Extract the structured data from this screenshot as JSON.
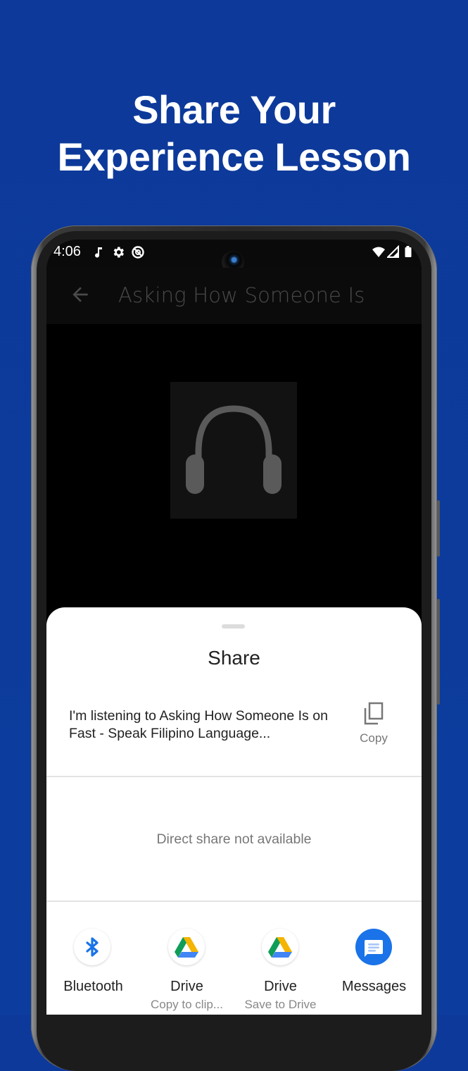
{
  "headline": {
    "line1": "Share Your",
    "line2": "Experience Lesson"
  },
  "status_bar": {
    "time": "4:06",
    "left_icons": [
      "music-note-icon",
      "settings-gear-icon",
      "no-data-icon"
    ],
    "right_icons": [
      "wifi-icon",
      "cell-signal-icon",
      "battery-icon"
    ]
  },
  "app_bar": {
    "back_icon": "arrow-back-icon",
    "title": "Asking How Someone Is"
  },
  "lesson_art": {
    "icon": "headphones-icon"
  },
  "share_sheet": {
    "title": "Share",
    "preview_text": "I'm listening to Asking How Someone Is on Fast - Speak Filipino Language...",
    "copy_label": "Copy",
    "direct_share_message": "Direct share not available",
    "targets": [
      {
        "name": "Bluetooth",
        "subtitle": "",
        "icon": "bluetooth-icon"
      },
      {
        "name": "Drive",
        "subtitle": "Copy to clip...",
        "icon": "google-drive-icon"
      },
      {
        "name": "Drive",
        "subtitle": "Save to Drive",
        "icon": "google-drive-icon"
      },
      {
        "name": "Messages",
        "subtitle": "",
        "icon": "messages-icon"
      }
    ]
  },
  "colors": {
    "background": "#0c3b9c",
    "messages_blue": "#1a73e8",
    "bluetooth_blue": "#1a73e8",
    "drive_green": "#0f9d58",
    "drive_yellow": "#f4b400",
    "drive_blue": "#4285f4"
  }
}
